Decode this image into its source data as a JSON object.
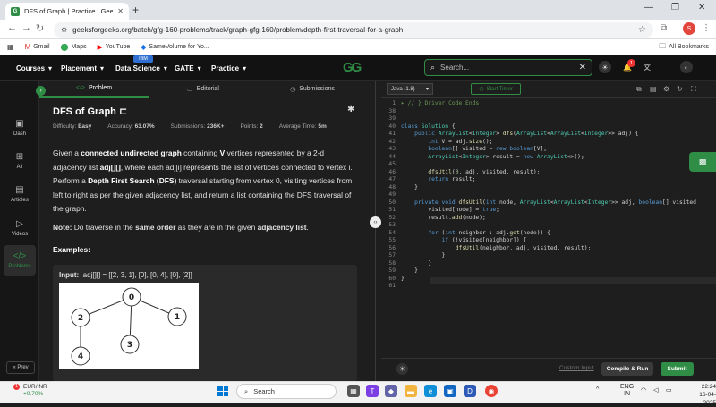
{
  "browser": {
    "tab_title": "DFS of Graph | Practice | Geeks",
    "url": "geeksforgeeks.org/batch/gfg-160-problems/track/graph-gfg-160/problem/depth-first-traversal-for-a-graph",
    "bookmarks": [
      "Gmail",
      "Maps",
      "YouTube",
      "SameVolume for Yo..."
    ],
    "all_bookmarks": "All Bookmarks"
  },
  "header": {
    "menu": [
      "Courses",
      "Placement",
      "Data Science",
      "GATE",
      "Practice"
    ],
    "ibm_badge": "IBM",
    "search_placeholder": "Search...",
    "notification_count": "1"
  },
  "sidebar": {
    "items": [
      "Dash",
      "All",
      "Articles",
      "Videos",
      "Problems"
    ],
    "prev": "Prev"
  },
  "problem_tabs": [
    "Problem",
    "Editorial",
    "Submissions"
  ],
  "problem": {
    "title": "DFS of Graph",
    "difficulty_label": "Difficulty:",
    "difficulty": "Easy",
    "accuracy_label": "Accuracy:",
    "accuracy": "63.07%",
    "submissions_label": "Submissions:",
    "submissions": "236K+",
    "points_label": "Points:",
    "points": "2",
    "time_label": "Average Time:",
    "time": "5m",
    "examples_title": "Examples:",
    "example_input_label": "Input:",
    "example_input": "adj[][] = [[2, 3, 1], [0], [0, 4], [0], [2]]",
    "graph_nodes": [
      "0",
      "1",
      "2",
      "3",
      "4"
    ]
  },
  "editor": {
    "language": "Java (1.8)",
    "timer": "Start Timer",
    "lines": [
      "1",
      "38",
      "39",
      "40",
      "41",
      "42",
      "43",
      "44",
      "45",
      "46",
      "47",
      "48",
      "49",
      "50",
      "51",
      "52",
      "53",
      "54",
      "55",
      "56",
      "57",
      "58",
      "59",
      "60",
      "61"
    ],
    "custom_input": "Custom Input",
    "compile": "Compile & Run",
    "submit": "Submit"
  },
  "taskbar": {
    "ticker_name": "EUR/INR",
    "ticker_change": "+0.70%",
    "ticker_badge": "1",
    "search": "Search",
    "lang": "ENG",
    "region": "IN",
    "time": "22:24",
    "date": "16-04-2025"
  }
}
